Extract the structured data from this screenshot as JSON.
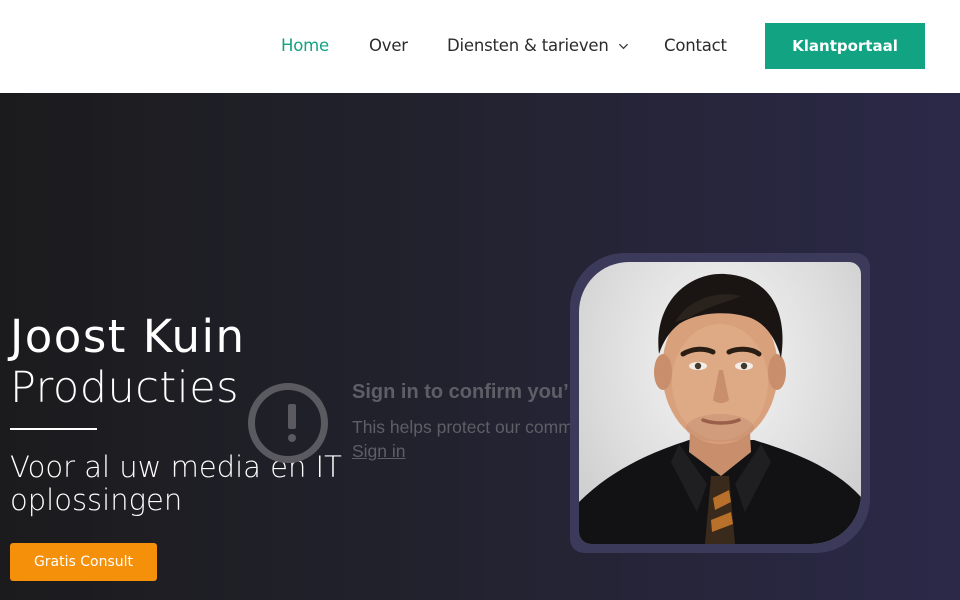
{
  "nav": {
    "items": [
      {
        "label": "Home",
        "active": true
      },
      {
        "label": "Over"
      },
      {
        "label": "Diensten & tarieven",
        "has_dropdown": true
      },
      {
        "label": "Contact"
      }
    ],
    "cta_label": "Klantportaal"
  },
  "hero": {
    "title": "Joost Kuin",
    "subtitle": "Producties",
    "tagline": "Voor al uw media en IT oplossingen",
    "button_label": "Gratis Consult"
  },
  "video_overlay": {
    "title": "Sign in to confirm you’r",
    "description": "This helps protect our comm",
    "link_label": "Sign in",
    "icon": "alert-circle-icon"
  },
  "portrait": {
    "icon": "portrait-photo"
  },
  "colors": {
    "accent": "#12a383",
    "cta_orange": "#f5900b",
    "hero_start": "#1b1b1d",
    "hero_end": "#2b2948"
  }
}
